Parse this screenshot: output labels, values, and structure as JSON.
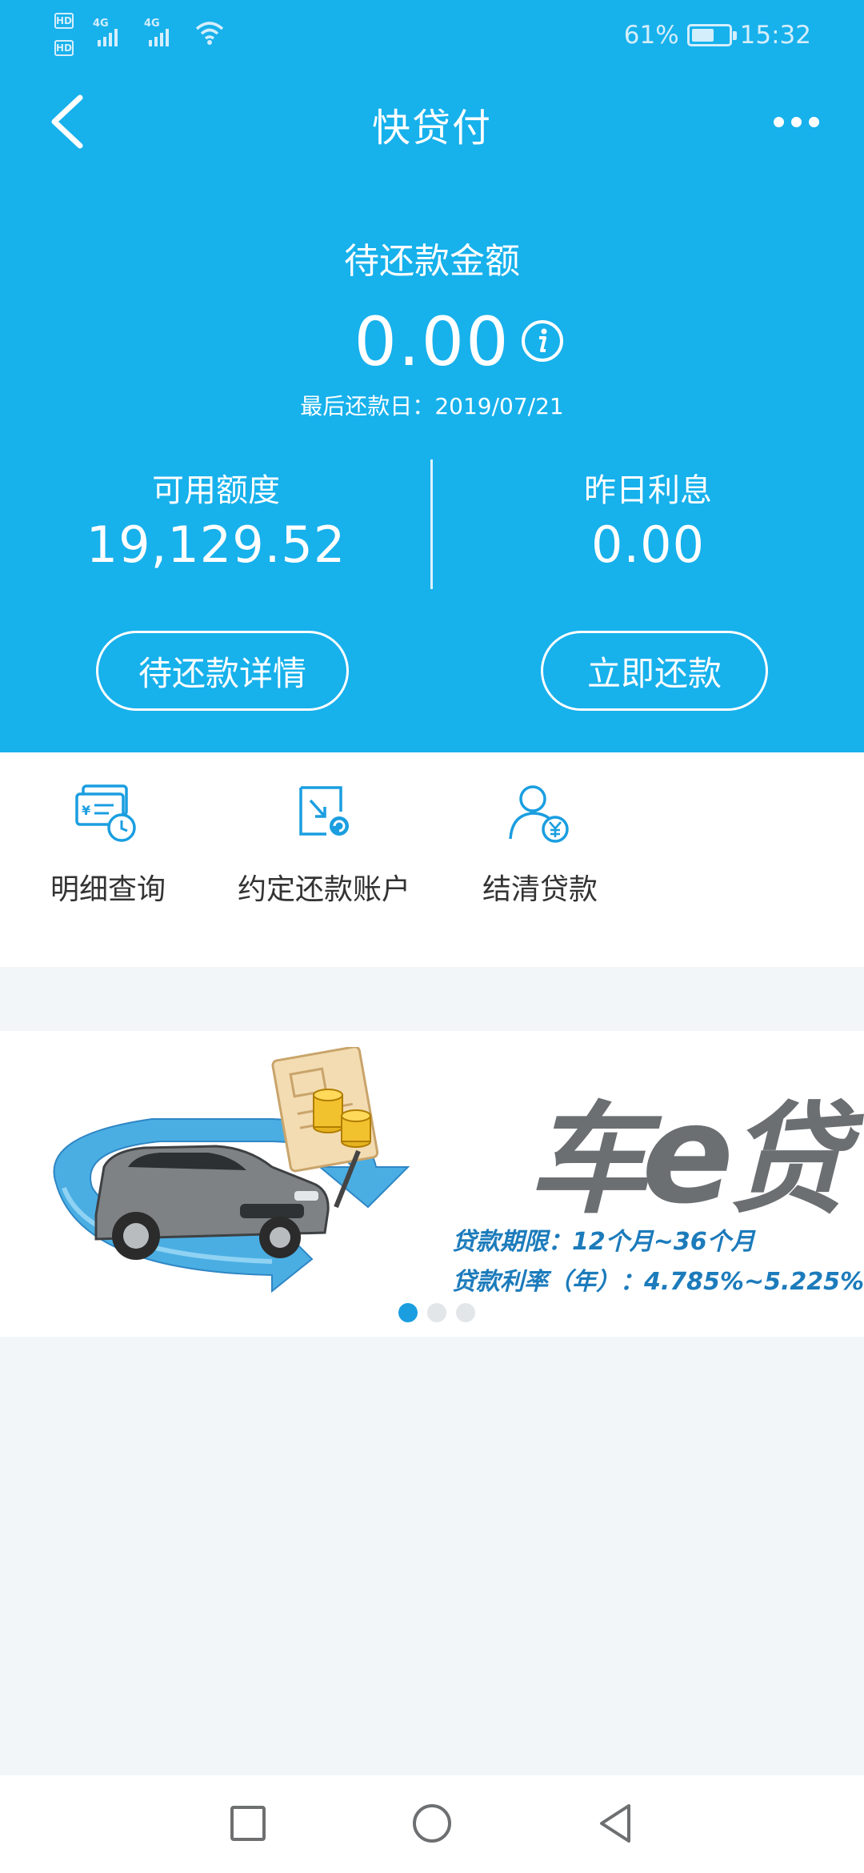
{
  "status_bar": {
    "hd1": "HD",
    "hd2": "HD",
    "net1": "4G",
    "net2": "4G",
    "battery_percent": "61%",
    "battery_level": 0.61,
    "time": "15:32",
    "icons": [
      "signal-icon",
      "wifi-icon",
      "battery-icon"
    ]
  },
  "header": {
    "title": "快贷付",
    "back_icon": "chevron-left-icon",
    "more_icon": "more-dots-icon"
  },
  "summary": {
    "due_label": "待还款金额",
    "due_amount": "0.00",
    "info_icon": "info-icon",
    "last_date_label": "最后还款日：",
    "last_date_value": "2019/07/21"
  },
  "stats": {
    "available_label": "可用额度",
    "available_value": "19,129.52",
    "interest_label": "昨日利息",
    "interest_value": "0.00"
  },
  "buttons": {
    "details": "待还款详情",
    "repay_now": "立即还款"
  },
  "actions": [
    {
      "label": "明细查询",
      "icon": "bill-clock-icon"
    },
    {
      "label": "约定还款账户",
      "icon": "account-arrow-icon"
    },
    {
      "label": "结清贷款",
      "icon": "user-yuan-icon"
    }
  ],
  "banner": {
    "brand_a": "车",
    "brand_e": "e",
    "brand_b": "贷",
    "term": "贷款期限：12个月~36个月",
    "rate": "贷款利率（年）：4.785%~5.225%",
    "active_slide": 1,
    "slide_count": 3
  },
  "system_nav": {
    "icons": [
      "recent-apps-icon",
      "home-icon",
      "back-icon"
    ]
  },
  "colors": {
    "header_bg": "#17b1ec",
    "page_bg": "#f2f6f9",
    "icon_accent": "#1a9ee0",
    "banner_text": "#1c7bbb"
  }
}
